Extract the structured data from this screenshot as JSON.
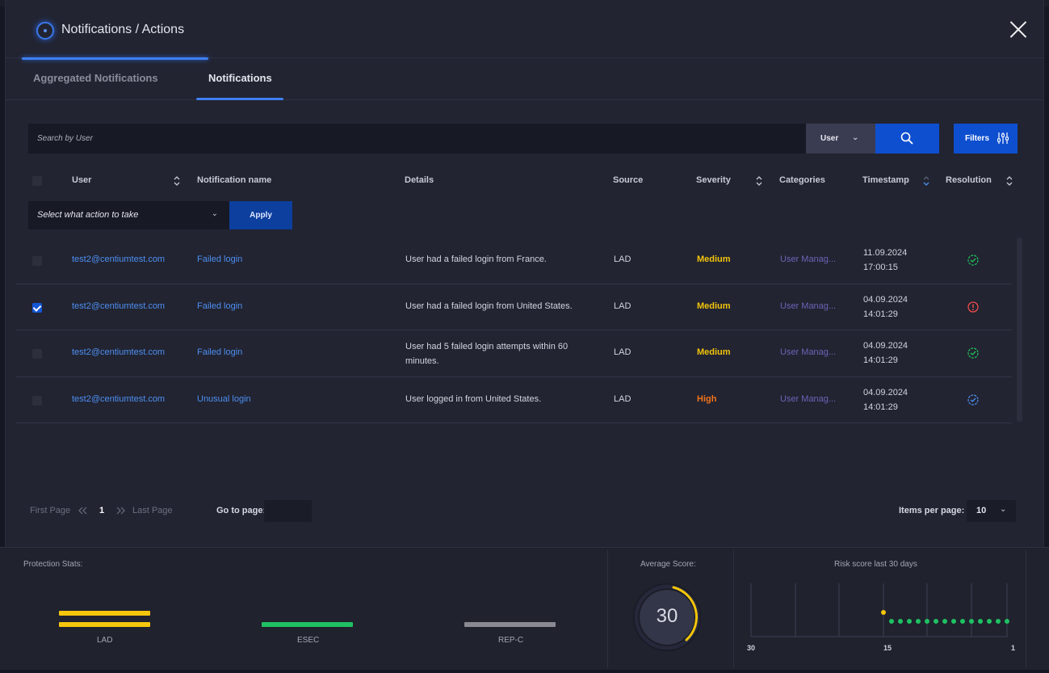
{
  "header": {
    "title": "Notifications / Actions"
  },
  "tabs": [
    {
      "label": "Aggregated Notifications",
      "active": false
    },
    {
      "label": "Notifications",
      "active": true
    }
  ],
  "search": {
    "placeholder": "Search by User",
    "field_value": "User",
    "filters_label": "Filters"
  },
  "table": {
    "columns": [
      "User",
      "Notification name",
      "Details",
      "Source",
      "Severity",
      "Categories",
      "Timestamp",
      "Resolution"
    ],
    "action_placeholder": "Select what action to take",
    "apply_label": "Apply",
    "rows": [
      {
        "checked": false,
        "user": "test2@centiumtest.com",
        "name": "Failed login",
        "details": "User had a failed login from France.",
        "source": "LAD",
        "severity": "Medium",
        "category": "User Manag...",
        "date": "11.09.2024",
        "time": "17:00:15",
        "resolution": "resolved-icon"
      },
      {
        "checked": true,
        "user": "test2@centiumtest.com",
        "name": "Failed login",
        "details": "User had a failed login from United States.",
        "source": "LAD",
        "severity": "Medium",
        "category": "User Manag...",
        "date": "04.09.2024",
        "time": "14:01:29",
        "resolution": "alert-icon"
      },
      {
        "checked": false,
        "user": "test2@centiumtest.com",
        "name": "Failed login",
        "details": "User had 5 failed login attempts within 60 minutes.",
        "source": "LAD",
        "severity": "Medium",
        "category": "User Manag...",
        "date": "04.09.2024",
        "time": "14:01:29",
        "resolution": "resolved-icon"
      },
      {
        "checked": false,
        "user": "test2@centiumtest.com",
        "name": "Unusual login",
        "details": "User logged in from United States.",
        "source": "LAD",
        "severity": "High",
        "category": "User Manag...",
        "date": "04.09.2024",
        "time": "14:01:29",
        "resolution": "acknowledged-icon"
      }
    ]
  },
  "pagination": {
    "first": "First Page",
    "current": "1",
    "last": "Last Page",
    "goto": "Go to page:",
    "items_label": "Items per page:",
    "items_value": "10"
  },
  "footer": {
    "protection_label": "Protection Stats:",
    "stats": [
      {
        "name": "LAD",
        "color": "#f5c60c"
      },
      {
        "name": "ESEC",
        "color": "#1fc163"
      },
      {
        "name": "REP-C",
        "color": "#8a8b92"
      }
    ],
    "avg_label": "Average Score:",
    "avg_value": "30",
    "risk_label": "Risk score last 30 days",
    "risk_axis": [
      "30",
      "15",
      "1"
    ]
  },
  "colors": {
    "accent": "#0e4fd0",
    "medium": "#f2c40c",
    "high": "#f2741c",
    "link": "#4d8ff2",
    "resolved": "#22c35e",
    "alert": "#f04b4b"
  }
}
